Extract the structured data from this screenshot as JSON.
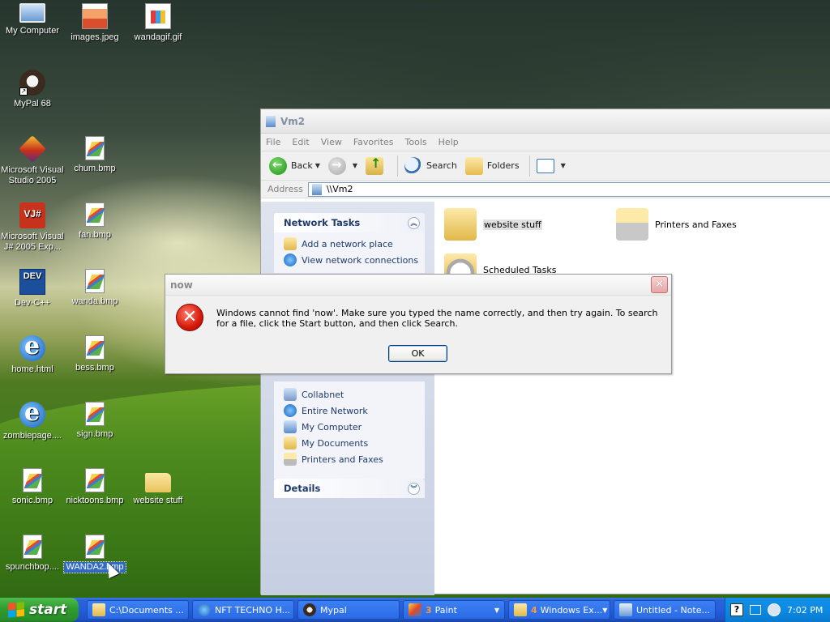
{
  "desktop": {
    "icons": [
      {
        "label": "My Computer"
      },
      {
        "label": "images.jpeg"
      },
      {
        "label": "wandagif.gif"
      },
      {
        "label": "MyPal 68"
      },
      {
        "label": "Microsoft Visual Studio 2005"
      },
      {
        "label": "chum.bmp"
      },
      {
        "label": "Microsoft Visual J# 2005 Exp..."
      },
      {
        "label": "fan.bmp"
      },
      {
        "label": "Dev-C++"
      },
      {
        "label": "wanda.bmp"
      },
      {
        "label": "home.html"
      },
      {
        "label": "bess.bmp"
      },
      {
        "label": "zombiepage...."
      },
      {
        "label": "sign.bmp"
      },
      {
        "label": "sonic.bmp"
      },
      {
        "label": "nicktoons.bmp"
      },
      {
        "label": "website stuff"
      },
      {
        "label": "spunchbop...."
      },
      {
        "label": "WANDA2.bmp"
      }
    ],
    "dev_icon_text": "DEV",
    "vj_icon_text": "VJ#"
  },
  "explorer": {
    "title": "Vm2",
    "menu": [
      "File",
      "Edit",
      "View",
      "Favorites",
      "Tools",
      "Help"
    ],
    "toolbar": {
      "back": "Back",
      "search": "Search",
      "folders": "Folders"
    },
    "address_label": "Address",
    "address_value": "\\\\Vm2",
    "network_tasks": {
      "title": "Network Tasks",
      "items": [
        "Add a network place",
        "View network connections"
      ]
    },
    "other_places": {
      "items": [
        "Collabnet",
        "Entire Network",
        "My Computer",
        "My Documents",
        "Printers and Faxes"
      ]
    },
    "details": {
      "title": "Details"
    },
    "content_items": [
      "website stuff",
      "Printers and Faxes",
      "Scheduled Tasks"
    ]
  },
  "dialog": {
    "title": "now",
    "message": "Windows cannot find 'now'. Make sure you typed the name correctly, and then try again. To search for a file, click the Start button, and then click Search.",
    "ok": "OK",
    "error_glyph": "✕",
    "close_glyph": "✕"
  },
  "taskbar": {
    "start": "start",
    "buttons": [
      {
        "label": "C:\\Documents ..."
      },
      {
        "label": "NFT TECHNO H..."
      },
      {
        "label": "Mypal"
      },
      {
        "count": "3",
        "label": "Paint"
      },
      {
        "count": "4",
        "label": "Windows Ex..."
      },
      {
        "label": "Untitled - Note..."
      }
    ],
    "clock": "7:02 PM",
    "help_glyph": "?"
  }
}
